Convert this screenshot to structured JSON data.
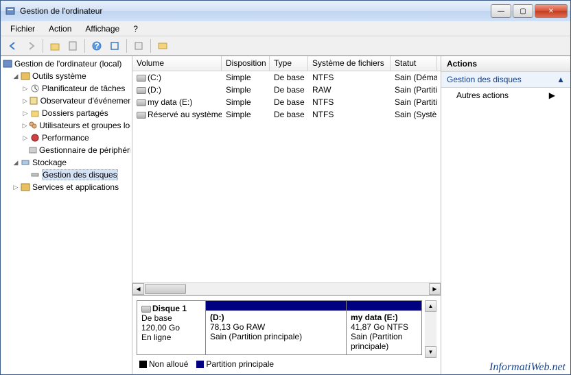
{
  "window": {
    "title": "Gestion de l'ordinateur"
  },
  "menu": [
    "Fichier",
    "Action",
    "Affichage",
    "?"
  ],
  "tree": {
    "root": "Gestion de l'ordinateur (local)",
    "sys_tools": "Outils système",
    "scheduler": "Planificateur de tâches",
    "events": "Observateur d'événements",
    "shared": "Dossiers partagés",
    "users": "Utilisateurs et groupes locaux",
    "perf": "Performance",
    "devmgr": "Gestionnaire de périphériques",
    "storage": "Stockage",
    "diskmgmt": "Gestion des disques",
    "services": "Services et applications"
  },
  "columns": {
    "volume": "Volume",
    "disposition": "Disposition",
    "type": "Type",
    "fs": "Système de fichiers",
    "status": "Statut"
  },
  "volumes": [
    {
      "name": "(C:)",
      "disp": "Simple",
      "type": "De base",
      "fs": "NTFS",
      "status": "Sain (Démarrage)"
    },
    {
      "name": "(D:)",
      "disp": "Simple",
      "type": "De base",
      "fs": "RAW",
      "status": "Sain (Partition)"
    },
    {
      "name": "my data (E:)",
      "disp": "Simple",
      "type": "De base",
      "fs": "NTFS",
      "status": "Sain (Partition)"
    },
    {
      "name": "Réservé au système",
      "disp": "Simple",
      "type": "De base",
      "fs": "NTFS",
      "status": "Sain (Système)"
    }
  ],
  "disk": {
    "label": "Disque 1",
    "type": "De base",
    "size": "120,00 Go",
    "status": "En ligne",
    "partitions": [
      {
        "name": "(D:)",
        "size_fs": "78,13 Go RAW",
        "status": "Sain (Partition principale)"
      },
      {
        "name": "my data  (E:)",
        "size_fs": "41,87 Go NTFS",
        "status": "Sain (Partition principale)"
      }
    ]
  },
  "legend": {
    "unalloc": "Non alloué",
    "primary": "Partition principale"
  },
  "actions": {
    "header": "Actions",
    "group": "Gestion des disques",
    "other": "Autres actions"
  },
  "watermark": "InformatiWeb.net"
}
